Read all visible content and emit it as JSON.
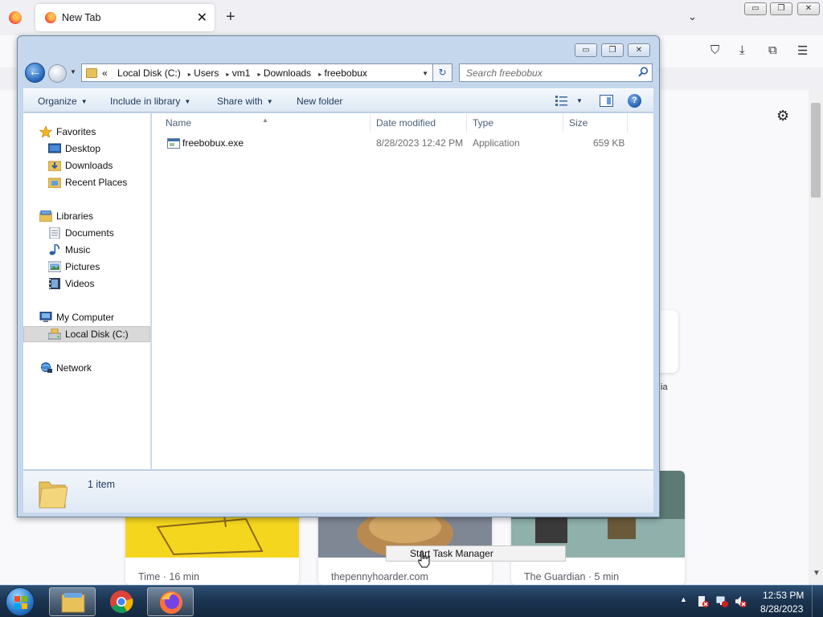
{
  "firefox": {
    "tab_title": "New Tab",
    "tab_close": "✕",
    "new_tab": "+",
    "tab_list": "⌄",
    "window_controls": [
      "▭",
      "❐",
      "✕"
    ],
    "toolbar_icons": [
      "pocket-icon",
      "download-icon",
      "extensions-icon",
      "menu-icon"
    ],
    "toolbar_glyphs": [
      "⛉",
      "⤓",
      "⧉",
      "☰"
    ],
    "settings_glyph": "⚙",
    "shortcut_label": "ia",
    "stories": [
      {
        "source": "Time · 16 min"
      },
      {
        "source": "thepennyhoarder.com"
      },
      {
        "source": "The Guardian · 5 min"
      }
    ],
    "context_popup": "Start Task Manager"
  },
  "explorer": {
    "window_controls": [
      "▭",
      "❐",
      "✕"
    ],
    "nav_back": "←",
    "address": {
      "prefix": "«",
      "crumbs": [
        "Local Disk (C:)",
        "Users",
        "vm1",
        "Downloads",
        "freebobux"
      ],
      "separator": "▸",
      "dropdown": "▼"
    },
    "refresh": "↻",
    "search": {
      "placeholder": "Search freebobux"
    },
    "commands": {
      "organize": "Organize",
      "include_in_library": "Include in library",
      "share_with": "Share with",
      "new_folder": "New folder",
      "caret": "▼",
      "help": "?"
    },
    "nav": {
      "favorites": "Favorites",
      "desktop": "Desktop",
      "downloads": "Downloads",
      "recent_places": "Recent Places",
      "libraries": "Libraries",
      "documents": "Documents",
      "music": "Music",
      "pictures": "Pictures",
      "videos": "Videos",
      "my_computer": "My Computer",
      "local_disk": "Local Disk (C:)",
      "network": "Network"
    },
    "columns": {
      "name": "Name",
      "date_modified": "Date modified",
      "type": "Type",
      "size": "Size",
      "sort_arrow": "▲"
    },
    "files": [
      {
        "name": "freebobux.exe",
        "date_modified": "8/28/2023 12:42 PM",
        "type": "Application",
        "size": "659 KB"
      }
    ],
    "details": {
      "count": "1 item"
    }
  },
  "taskbar": {
    "tray_arrow": "▲",
    "time": "12:53 PM",
    "date": "8/28/2023"
  },
  "colors": {
    "explorer_frame": "#c5d7ec",
    "taskbar": "#1c3552",
    "firefox_chrome": "#f0f0f4"
  }
}
